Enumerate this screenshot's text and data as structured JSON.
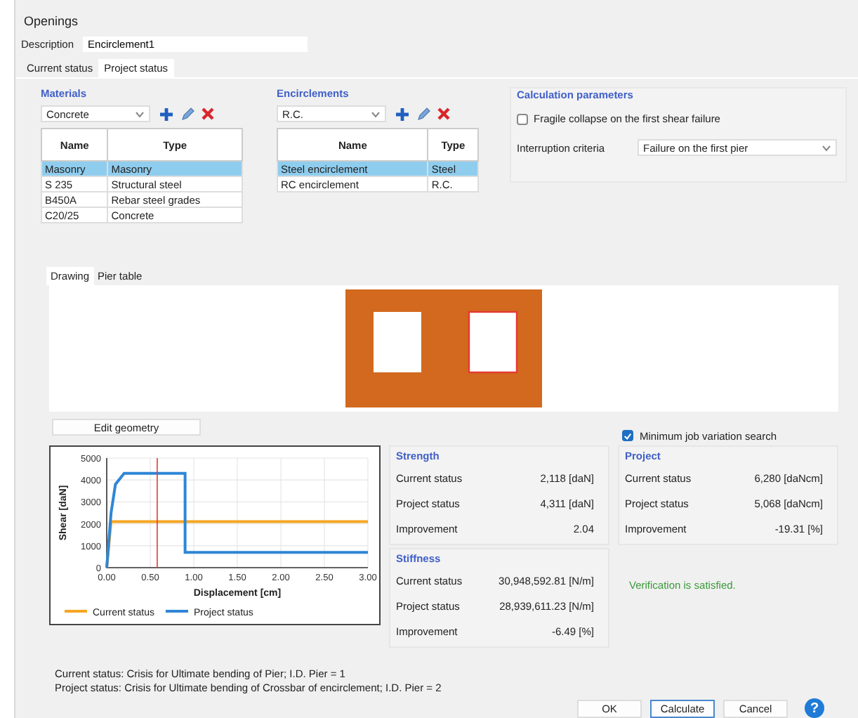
{
  "window": {
    "title": "Openings"
  },
  "description": {
    "label": "Description",
    "value": "Encirclement1"
  },
  "tabs": [
    {
      "label": "Current status",
      "selected": false
    },
    {
      "label": "Project status",
      "selected": true
    }
  ],
  "materials": {
    "title": "Materials",
    "combo": "Concrete",
    "columns": [
      "Name",
      "Type"
    ],
    "rows": [
      {
        "cells": [
          "Masonry",
          "Masonry"
        ],
        "selected": true
      },
      {
        "cells": [
          "S 235",
          "Structural steel"
        ],
        "selected": false
      },
      {
        "cells": [
          "B450A",
          "Rebar steel grades"
        ],
        "selected": false
      },
      {
        "cells": [
          "C20/25",
          "Concrete"
        ],
        "selected": false
      }
    ]
  },
  "encirclements": {
    "title": "Encirclements",
    "combo": "R.C.",
    "columns": [
      "Name",
      "Type"
    ],
    "rows": [
      {
        "cells": [
          "Steel encirclement",
          "Steel"
        ],
        "selected": true
      },
      {
        "cells": [
          "RC encirclement",
          "R.C."
        ],
        "selected": false
      }
    ]
  },
  "calculation_parameters": {
    "title": "Calculation parameters",
    "fragile_collapse": {
      "label": "Fragile collapse on the first shear failure",
      "checked": false
    },
    "interruption_criteria": {
      "label": "Interruption criteria",
      "value": "Failure on the first pier"
    }
  },
  "view_tabs": [
    {
      "label": "Drawing",
      "selected": true
    },
    {
      "label": "Pier table",
      "selected": false
    }
  ],
  "drawing": {
    "openings": [
      {
        "selected": false
      },
      {
        "selected": true
      }
    ]
  },
  "edit_geometry_button": "Edit geometry",
  "minimum_job_variation": {
    "label": "Minimum job variation search",
    "checked": true
  },
  "chart_data": {
    "type": "line",
    "xlabel": "Displacement [cm]",
    "ylabel": "Shear [daN]",
    "x": [
      0,
      0.05,
      0.1,
      0.2,
      0.9,
      0.9,
      3.0
    ],
    "series": [
      {
        "name": "Current status",
        "color": "#f5a623",
        "values": [
          0,
          2100,
          2100,
          2100,
          2100,
          2100,
          2100
        ]
      },
      {
        "name": "Project status",
        "color": "#2f86d6",
        "values": [
          0,
          2500,
          3800,
          4300,
          4300,
          700,
          700
        ]
      }
    ],
    "xlim": [
      0,
      3
    ],
    "ylim": [
      0,
      5000
    ],
    "xticks": [
      {
        "value": 0,
        "label": "0.00"
      },
      {
        "value": 0.5,
        "label": "0.50"
      },
      {
        "value": 1,
        "label": "1.00"
      },
      {
        "value": 1.5,
        "label": "1.50"
      },
      {
        "value": 2,
        "label": "2.00"
      },
      {
        "value": 2.5,
        "label": "2.50"
      },
      {
        "value": 3,
        "label": "3.00"
      }
    ],
    "yticks": [
      0,
      1000,
      2000,
      3000,
      4000,
      5000
    ],
    "grid": true,
    "legend": true,
    "ref_lines": [
      {
        "axis": "x",
        "value": 0.58,
        "color": "#e53935"
      }
    ]
  },
  "strength": {
    "title": "Strength",
    "rows": [
      {
        "label": "Current status",
        "value": "2,118 [daN]"
      },
      {
        "label": "Project status",
        "value": "4,311 [daN]"
      },
      {
        "label": "Improvement",
        "value": "2.04"
      }
    ]
  },
  "stiffness": {
    "title": "Stiffness",
    "rows": [
      {
        "label": "Current status",
        "value": "30,948,592.81 [N/m]"
      },
      {
        "label": "Project status",
        "value": "28,939,611.23 [N/m]"
      },
      {
        "label": "Improvement",
        "value": "-6.49 [%]"
      }
    ]
  },
  "project": {
    "title": "Project",
    "rows": [
      {
        "label": "Current status",
        "value": "6,280 [daNcm]"
      },
      {
        "label": "Project status",
        "value": "5,068 [daNcm]"
      },
      {
        "label": "Improvement",
        "value": "-19.31 [%]"
      }
    ]
  },
  "verification": "Verification is satisfied.",
  "messages": [
    "Current status: Crisis for Ultimate bending of Pier; I.D. Pier = 1",
    "Project status: Crisis for Ultimate bending of Crossbar of encirclement; I.D. Pier = 2"
  ],
  "buttons": [
    {
      "label": "OK",
      "default": false
    },
    {
      "label": "Calculate",
      "default": true
    },
    {
      "label": "Cancel",
      "default": false
    }
  ],
  "help": "?"
}
